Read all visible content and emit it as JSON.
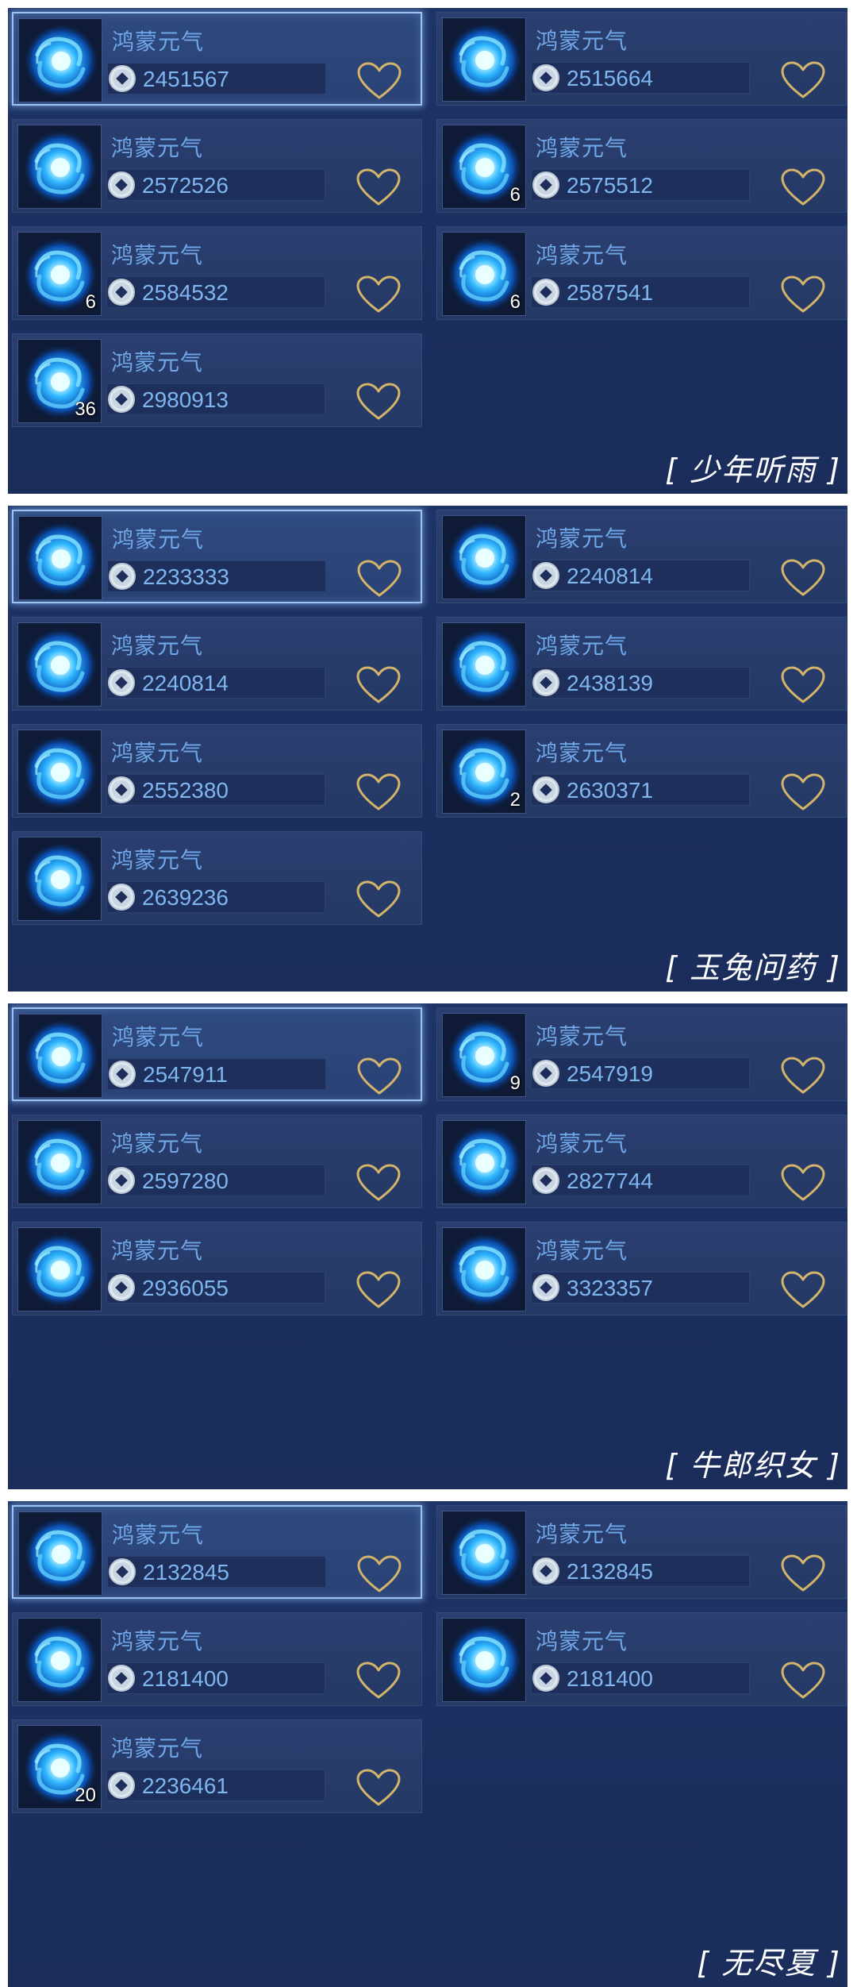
{
  "item_label": "鸿蒙元气",
  "colors": {
    "panel_bg": "#1f3466",
    "card_bg": "#2a3f70",
    "name_text": "#6fa7e8",
    "price_text": "#7fb6ef",
    "heart": "#d4b46a",
    "caption": "#ffffff"
  },
  "icons": {
    "item": "blue-vortex-icon",
    "coin": "silver-coin-icon",
    "favorite": "heart-outline-icon"
  },
  "panels": [
    {
      "caption": "[ 少年听雨 ]",
      "cards": [
        {
          "name": "鸿蒙元气",
          "price": "2451567",
          "count": "",
          "selected": true
        },
        {
          "name": "鸿蒙元气",
          "price": "2515664",
          "count": "",
          "selected": false
        },
        {
          "name": "鸿蒙元气",
          "price": "2572526",
          "count": "",
          "selected": false
        },
        {
          "name": "鸿蒙元气",
          "price": "2575512",
          "count": "6",
          "selected": false
        },
        {
          "name": "鸿蒙元气",
          "price": "2584532",
          "count": "6",
          "selected": false
        },
        {
          "name": "鸿蒙元气",
          "price": "2587541",
          "count": "6",
          "selected": false
        },
        {
          "name": "鸿蒙元气",
          "price": "2980913",
          "count": "36",
          "selected": false
        }
      ]
    },
    {
      "caption": "[ 玉兔问药 ]",
      "cards": [
        {
          "name": "鸿蒙元气",
          "price": "2233333",
          "count": "",
          "selected": true
        },
        {
          "name": "鸿蒙元气",
          "price": "2240814",
          "count": "",
          "selected": false
        },
        {
          "name": "鸿蒙元气",
          "price": "2240814",
          "count": "",
          "selected": false
        },
        {
          "name": "鸿蒙元气",
          "price": "2438139",
          "count": "",
          "selected": false
        },
        {
          "name": "鸿蒙元气",
          "price": "2552380",
          "count": "",
          "selected": false
        },
        {
          "name": "鸿蒙元气",
          "price": "2630371",
          "count": "2",
          "selected": false
        },
        {
          "name": "鸿蒙元气",
          "price": "2639236",
          "count": "",
          "selected": false
        }
      ]
    },
    {
      "caption": "[ 牛郎织女 ]",
      "cards": [
        {
          "name": "鸿蒙元气",
          "price": "2547911",
          "count": "",
          "selected": true
        },
        {
          "name": "鸿蒙元气",
          "price": "2547919",
          "count": "9",
          "selected": false
        },
        {
          "name": "鸿蒙元气",
          "price": "2597280",
          "count": "",
          "selected": false
        },
        {
          "name": "鸿蒙元气",
          "price": "2827744",
          "count": "",
          "selected": false
        },
        {
          "name": "鸿蒙元气",
          "price": "2936055",
          "count": "",
          "selected": false
        },
        {
          "name": "鸿蒙元气",
          "price": "3323357",
          "count": "",
          "selected": false
        }
      ]
    },
    {
      "caption": "[ 无尽夏 ]",
      "cards": [
        {
          "name": "鸿蒙元气",
          "price": "2132845",
          "count": "",
          "selected": true
        },
        {
          "name": "鸿蒙元气",
          "price": "2132845",
          "count": "",
          "selected": false
        },
        {
          "name": "鸿蒙元气",
          "price": "2181400",
          "count": "",
          "selected": false
        },
        {
          "name": "鸿蒙元气",
          "price": "2181400",
          "count": "",
          "selected": false
        },
        {
          "name": "鸿蒙元气",
          "price": "2236461",
          "count": "20",
          "selected": false
        }
      ]
    }
  ]
}
